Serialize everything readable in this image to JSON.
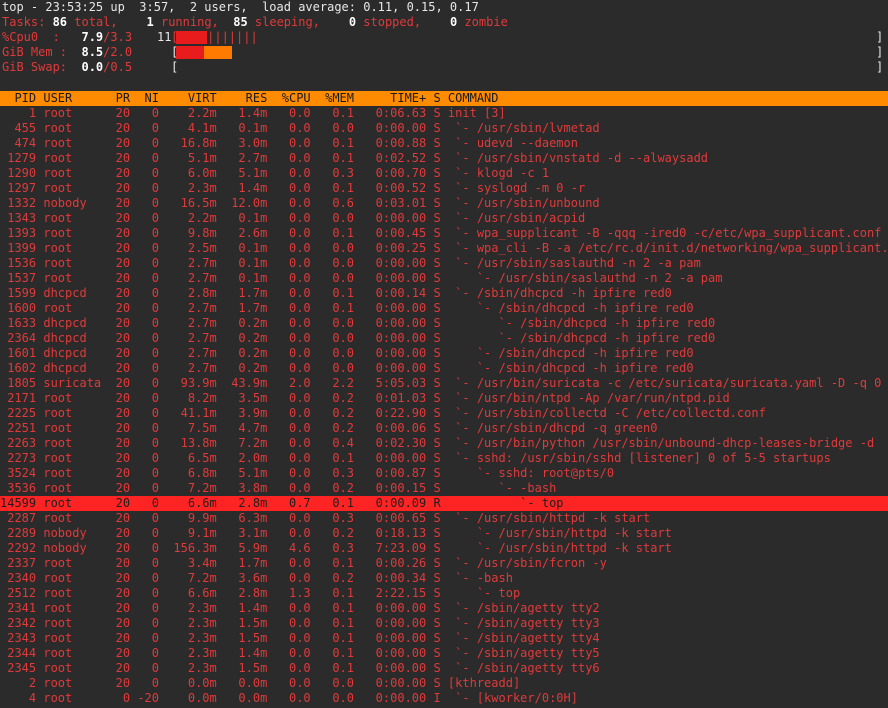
{
  "summary": {
    "line1": "top - 23:53:25 up  3:57,  2 users,  load average: 0.11, 0.15, 0.17",
    "tasks_label": "Tasks:",
    "tasks_total": " 86",
    "tasks_total_label": " total,",
    "tasks_running": "    1",
    "tasks_running_label": " running,",
    "tasks_sleeping": "  85",
    "tasks_sleeping_label": " sleeping,",
    "tasks_stopped": "    0",
    "tasks_stopped_label": " stopped,",
    "tasks_zombie": "    0",
    "tasks_zombie_label": " zombie",
    "cpu_label": "%Cpu0  :",
    "cpu_user": "   7.9",
    "cpu_sys": "/3.3",
    "cpu_pct": "11",
    "cpu_bar": "[|||||||||||",
    "mem_label": "GiB Mem :",
    "mem_used": "  8.5",
    "mem_total": "/2.0",
    "mem_bracket": "[",
    "swap_label": "GiB Swap:",
    "swap_used": "  0.0",
    "swap_total": "/0.5",
    "swap_bracket": "[",
    "close_bracket": "]",
    "cpu_fill_fraction": 0.11,
    "mem_fill_fraction": 0.85
  },
  "columns": "  PID USER      PR  NI    VIRT    RES  %CPU  %MEM     TIME+ S COMMAND",
  "processes": [
    "    1 root      20   0    2.2m   1.4m   0.0   0.1   0:06.63 S init [3]",
    "  455 root      20   0    4.1m   0.1m   0.0   0.0   0:00.00 S  `- /usr/sbin/lvmetad",
    "  474 root      20   0   16.8m   3.0m   0.0   0.1   0:00.88 S  `- udevd --daemon",
    " 1279 root      20   0    5.1m   2.7m   0.0   0.1   0:02.52 S  `- /usr/sbin/vnstatd -d --alwaysadd",
    " 1290 root      20   0    6.0m   5.1m   0.0   0.3   0:00.70 S  `- klogd -c 1",
    " 1297 root      20   0    2.3m   1.4m   0.0   0.1   0:00.52 S  `- syslogd -m 0 -r",
    " 1332 nobody    20   0   16.5m  12.0m   0.0   0.6   0:03.01 S  `- /usr/sbin/unbound",
    " 1343 root      20   0    2.2m   0.1m   0.0   0.0   0:00.00 S  `- /usr/sbin/acpid",
    " 1393 root      20   0    9.8m   2.6m   0.0   0.1   0:00.45 S  `- wpa_supplicant -B -qqq -ired0 -c/etc/wpa_supplicant.conf",
    " 1399 root      20   0    2.5m   0.1m   0.0   0.0   0:00.25 S  `- wpa_cli -B -a /etc/rc.d/init.d/networking/wpa_supplicant.exe",
    " 1536 root      20   0    2.7m   0.1m   0.0   0.0   0:00.00 S  `- /usr/sbin/saslauthd -n 2 -a pam",
    " 1537 root      20   0    2.7m   0.1m   0.0   0.0   0:00.00 S     `- /usr/sbin/saslauthd -n 2 -a pam",
    " 1599 dhcpcd    20   0    2.8m   1.7m   0.0   0.1   0:00.14 S  `- /sbin/dhcpcd -h ipfire red0",
    " 1600 root      20   0    2.7m   1.7m   0.0   0.1   0:00.00 S     `- /sbin/dhcpcd -h ipfire red0",
    " 1633 dhcpcd    20   0    2.7m   0.2m   0.0   0.0   0:00.00 S        `- /sbin/dhcpcd -h ipfire red0",
    " 2364 dhcpcd    20   0    2.7m   0.2m   0.0   0.0   0:00.00 S        `- /sbin/dhcpcd -h ipfire red0",
    " 1601 dhcpcd    20   0    2.7m   0.2m   0.0   0.0   0:00.00 S     `- /sbin/dhcpcd -h ipfire red0",
    " 1602 dhcpcd    20   0    2.7m   0.2m   0.0   0.0   0:00.00 S     `- /sbin/dhcpcd -h ipfire red0",
    " 1805 suricata  20   0   93.9m  43.9m   2.0   2.2   5:05.03 S  `- /usr/bin/suricata -c /etc/suricata/suricata.yaml -D -q 0",
    " 2171 root      20   0    8.2m   3.5m   0.0   0.2   0:01.03 S  `- /usr/bin/ntpd -Ap /var/run/ntpd.pid",
    " 2225 root      20   0   41.1m   3.9m   0.0   0.2   0:22.90 S  `- /usr/sbin/collectd -C /etc/collectd.conf",
    " 2251 root      20   0    7.5m   4.7m   0.0   0.2   0:00.06 S  `- /usr/sbin/dhcpd -q green0",
    " 2263 root      20   0   13.8m   7.2m   0.0   0.4   0:02.30 S  `- /usr/bin/python /usr/sbin/unbound-dhcp-leases-bridge -d",
    " 2273 root      20   0    6.5m   2.0m   0.0   0.1   0:00.00 S  `- sshd: /usr/sbin/sshd [listener] 0 of 5-5 startups",
    " 3524 root      20   0    6.8m   5.1m   0.0   0.3   0:00.87 S     `- sshd: root@pts/0",
    " 3536 root      20   0    7.2m   3.8m   0.0   0.2   0:00.15 S        `- -bash",
    "14599 root      20   0    6.6m   2.8m   0.7   0.1   0:00.09 R           `- top",
    " 2287 root      20   0    9.9m   6.3m   0.0   0.3   0:00.65 S  `- /usr/sbin/httpd -k start",
    " 2289 nobody    20   0    9.1m   3.1m   0.0   0.2   0:18.13 S     `- /usr/sbin/httpd -k start",
    " 2292 nobody    20   0  156.3m   5.9m   4.6   0.3   7:23.09 S     `- /usr/sbin/httpd -k start",
    " 2337 root      20   0    3.4m   1.7m   0.0   0.1   0:00.26 S  `- /usr/sbin/fcron -y",
    " 2340 root      20   0    7.2m   3.6m   0.0   0.2   0:00.34 S  `- -bash",
    " 2512 root      20   0    6.6m   2.8m   1.3   0.1   2:22.15 S     `- top",
    " 2341 root      20   0    2.3m   1.4m   0.0   0.1   0:00.00 S  `- /sbin/agetty tty2",
    " 2342 root      20   0    2.3m   1.5m   0.0   0.1   0:00.00 S  `- /sbin/agetty tty3",
    " 2343 root      20   0    2.3m   1.5m   0.0   0.1   0:00.00 S  `- /sbin/agetty tty4",
    " 2344 root      20   0    2.3m   1.4m   0.0   0.1   0:00.00 S  `- /sbin/agetty tty5",
    " 2345 root      20   0    2.3m   1.5m   0.0   0.1   0:00.00 S  `- /sbin/agetty tty6",
    "    2 root      20   0    0.0m   0.0m   0.0   0.0   0:00.00 S [kthreadd]",
    "    4 root       0 -20    0.0m   0.0m   0.0   0.0   0:00.00 I  `- [kworker/0:0H]"
  ],
  "selected_index": 26,
  "colors": {
    "background": "#2b2b2b",
    "header_bar": "#ff8c00",
    "selected_row": "#ff2424",
    "text_red": "#e03a3a",
    "bar_red": "#e81c1c",
    "bar_orange": "#ff7a00"
  }
}
